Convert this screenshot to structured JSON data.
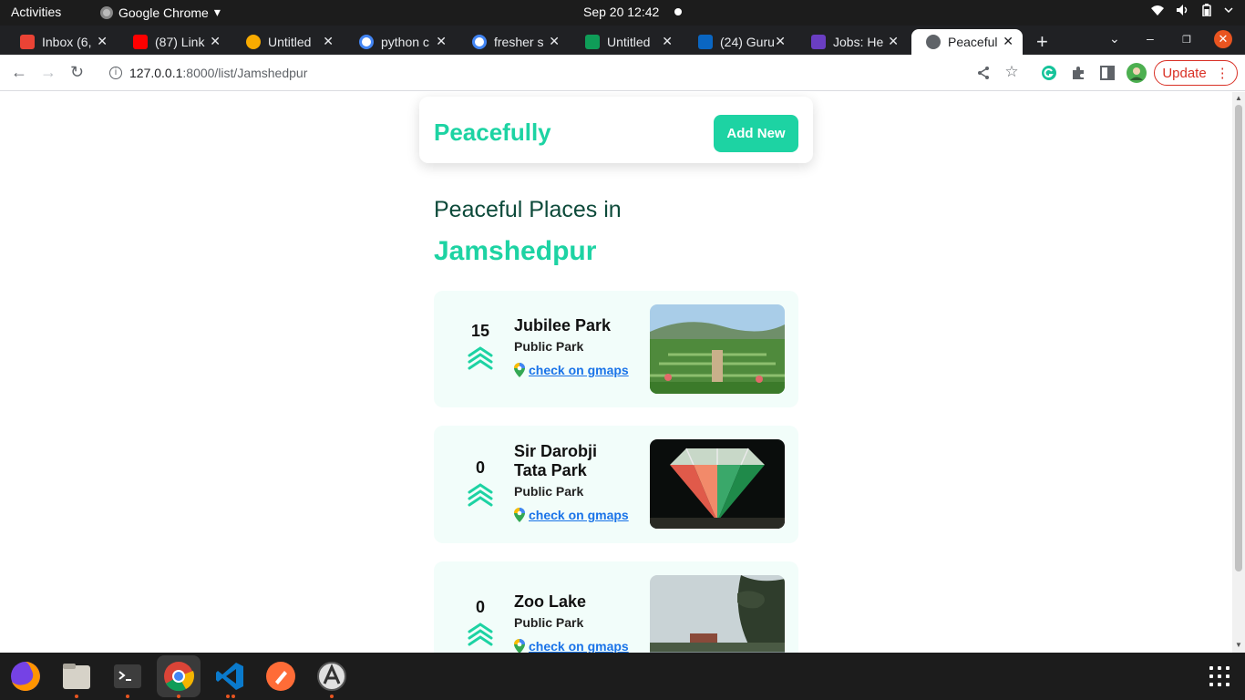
{
  "system": {
    "activities": "Activities",
    "app_name": "Google Chrome",
    "clock": "Sep 20  12:42"
  },
  "tabs": [
    {
      "title": "Inbox (6,",
      "favicon": "gmail-icon",
      "color": "#ea4335"
    },
    {
      "title": "(87) Link",
      "favicon": "youtube-icon",
      "color": "#ff0000"
    },
    {
      "title": "Untitled",
      "favicon": "colab-icon",
      "color": "#f9ab00"
    },
    {
      "title": "python c",
      "favicon": "google-icon",
      "color": "#4285f4"
    },
    {
      "title": "fresher s",
      "favicon": "google-icon",
      "color": "#4285f4"
    },
    {
      "title": "Untitled",
      "favicon": "sheets-icon",
      "color": "#0f9d58"
    },
    {
      "title": "(24) Guru",
      "favicon": "linkedin-icon",
      "color": "#0a66c2"
    },
    {
      "title": "Jobs: He",
      "favicon": "jobs-icon",
      "color": "#6a3ec2"
    },
    {
      "title": "Peaceful",
      "favicon": "globe-icon",
      "color": "#5f6368",
      "active": true
    }
  ],
  "toolbar": {
    "url_host": "127.0.0.1",
    "url_path": ":8000/list/Jamshedpur",
    "update_label": "Update"
  },
  "page": {
    "brand": "Peacefully",
    "add_new": "Add New",
    "heading_line1": "Peaceful Places in",
    "heading_city": "Jamshedpur",
    "gmaps_label": "check on gmaps",
    "accent_color": "#1dd3a3",
    "places": [
      {
        "votes": "15",
        "name": "Jubilee Park",
        "category": "Public Park",
        "photo": "garden-photo"
      },
      {
        "votes": "0",
        "name": "Sir Darobji Tata Park",
        "category": "Public Park",
        "photo": "lit-diamond-photo"
      },
      {
        "votes": "0",
        "name": "Zoo Lake",
        "category": "Public Park",
        "photo": "lake-photo"
      }
    ]
  },
  "dock": [
    "firefox-icon",
    "files-icon",
    "terminal-icon",
    "chrome-icon",
    "vscode-icon",
    "postman-icon",
    "software-updater-icon",
    "app-grid-icon"
  ]
}
